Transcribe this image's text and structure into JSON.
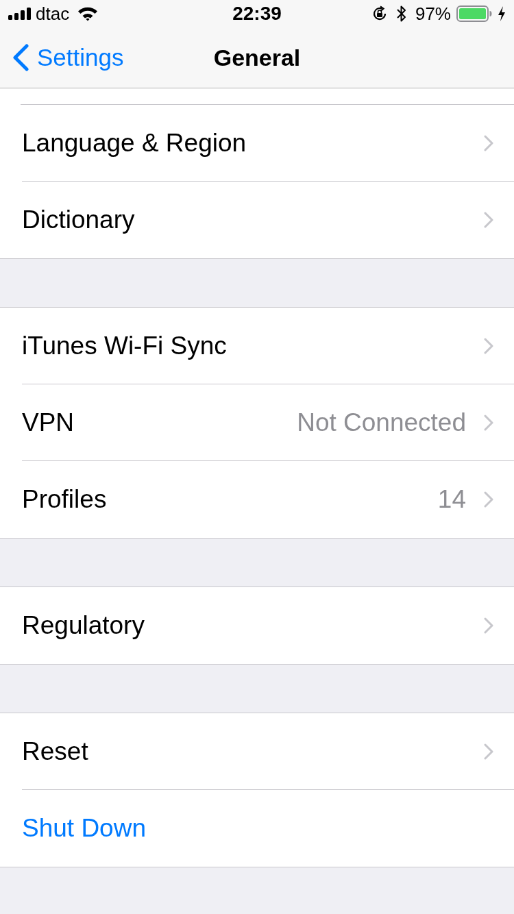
{
  "status_bar": {
    "carrier": "dtac",
    "time": "22:39",
    "battery_percent": "97%",
    "charging": true
  },
  "nav_bar": {
    "back_label": "Settings",
    "title": "General"
  },
  "groups": [
    {
      "items": [
        {
          "kind": "disclosure",
          "label": "Language & Region"
        },
        {
          "kind": "disclosure",
          "label": "Dictionary"
        }
      ]
    },
    {
      "items": [
        {
          "kind": "disclosure",
          "label": "iTunes Wi-Fi Sync"
        },
        {
          "kind": "disclosure",
          "label": "VPN",
          "value": "Not Connected"
        },
        {
          "kind": "disclosure",
          "label": "Profiles",
          "value": "14"
        }
      ]
    },
    {
      "items": [
        {
          "kind": "disclosure",
          "label": "Regulatory"
        }
      ]
    },
    {
      "items": [
        {
          "kind": "disclosure",
          "label": "Reset"
        },
        {
          "kind": "action",
          "label": "Shut Down"
        }
      ]
    }
  ]
}
